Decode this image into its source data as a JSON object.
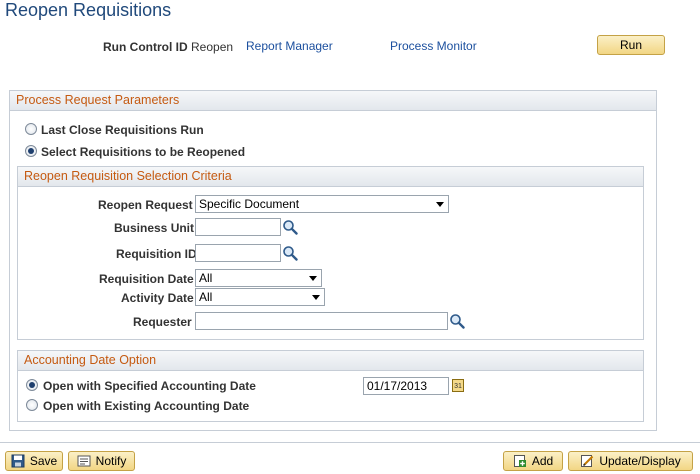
{
  "page": {
    "title": "Reopen Requisitions"
  },
  "run_control": {
    "label": "Run Control ID",
    "value": "Reopen",
    "report_manager": "Report Manager",
    "process_monitor": "Process Monitor",
    "run_button": "Run"
  },
  "process_params": {
    "header": "Process Request Parameters",
    "options": [
      {
        "label": "Last Close Requisitions Run",
        "selected": false
      },
      {
        "label": "Select Requisitions to be Reopened",
        "selected": true
      }
    ]
  },
  "criteria": {
    "header": "Reopen Requisition Selection Criteria",
    "reopen_request": {
      "label": "Reopen Request",
      "value": "Specific Document"
    },
    "business_unit": {
      "label": "Business Unit",
      "value": ""
    },
    "requisition_id": {
      "label": "Requisition ID",
      "value": ""
    },
    "requisition_date": {
      "label": "Requisition Date",
      "value": "All"
    },
    "activity_date": {
      "label": "Activity Date",
      "value": "All"
    },
    "requester": {
      "label": "Requester",
      "value": ""
    }
  },
  "accounting": {
    "header": "Accounting Date Option",
    "options": [
      {
        "label": "Open with Specified Accounting Date",
        "selected": true
      },
      {
        "label": "Open with Existing Accounting Date",
        "selected": false
      }
    ],
    "date_value": "01/17/2013",
    "calendar_glyph": "31"
  },
  "toolbar": {
    "save": "Save",
    "notify": "Notify",
    "add": "Add",
    "update_display": "Update/Display"
  },
  "icons": {
    "lookup": "magnifier-icon",
    "calendar": "calendar-icon",
    "save": "save-icon",
    "notify": "notify-icon",
    "add": "add-icon",
    "update": "update-display-icon"
  },
  "colors": {
    "title": "#20497b",
    "link": "#1b4f9e",
    "group_header_text": "#c55a11",
    "button_top": "#fbf0c7",
    "button_bottom": "#f2d684"
  }
}
